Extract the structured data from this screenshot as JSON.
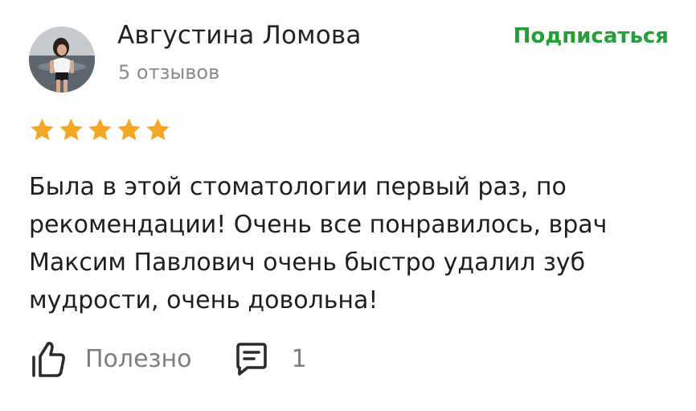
{
  "review": {
    "author": {
      "name": "Августина Ломова",
      "reviews_count": "5 отзывов",
      "avatar_icon": "user-photo-avatar"
    },
    "subscribe_label": "Подписаться",
    "rating": {
      "value": 5,
      "max": 5,
      "star_color": "#f5a623"
    },
    "text": "Была в этой стоматологии первый раз, по\nрекомендации! Очень все понравилось, врач\nМаксим Павлович очень быстро удалил зуб\nмудрости, очень довольна!",
    "actions": {
      "helpful_label": "Полезно",
      "helpful_icon": "thumbs-up-icon",
      "comments_count": "1",
      "comments_icon": "comment-icon"
    },
    "accent_color": "#21a038"
  }
}
